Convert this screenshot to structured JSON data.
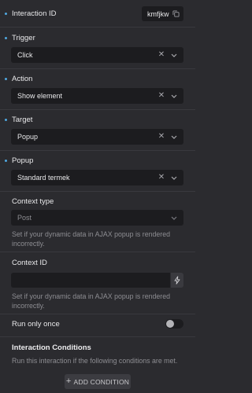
{
  "interaction_id": {
    "label": "Interaction ID",
    "value": "kmfjkw",
    "copy_icon": "copy-icon"
  },
  "trigger": {
    "label": "Trigger",
    "value": "Click"
  },
  "action": {
    "label": "Action",
    "value": "Show element"
  },
  "target": {
    "label": "Target",
    "value": "Popup"
  },
  "popup": {
    "label": "Popup",
    "value": "Standard termek"
  },
  "context_type": {
    "label": "Context type",
    "value": "Post",
    "help": "Set if your dynamic data in AJAX popup is rendered incorrectly."
  },
  "context_id": {
    "label": "Context ID",
    "value": "",
    "help": "Set if your dynamic data in AJAX popup is rendered incorrectly.",
    "dynamic_icon": "bolt-icon"
  },
  "run_only_once": {
    "label": "Run only once",
    "enabled": false
  },
  "conditions": {
    "heading": "Interaction Conditions",
    "description": "Run this interaction if the following conditions are met.",
    "add_button": "ADD CONDITION"
  },
  "colors": {
    "background": "#2b2b2f",
    "field": "#1c1c1f",
    "accent_dot": "#4fa8e0",
    "muted_text": "#8d8d92"
  }
}
